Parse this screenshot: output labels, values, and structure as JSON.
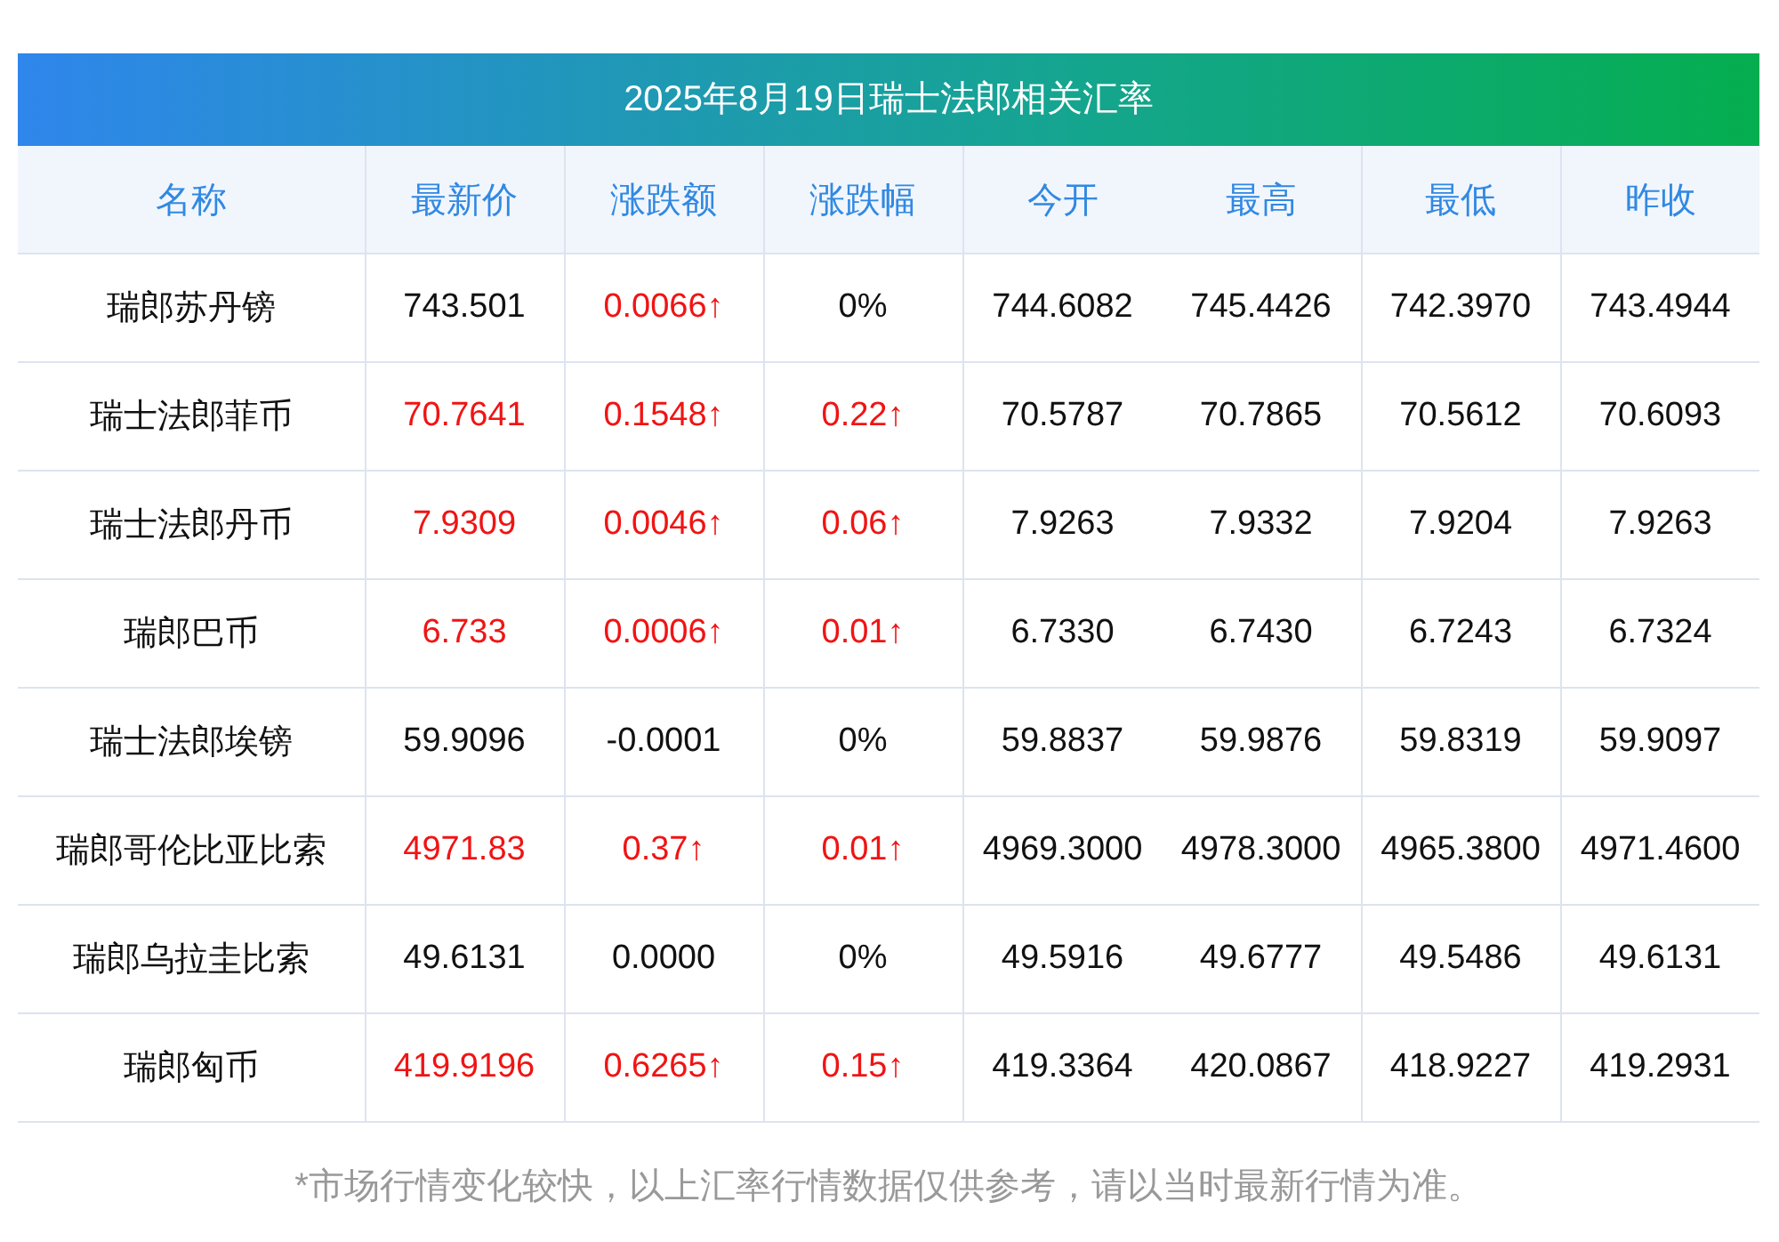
{
  "title": "2025年8月19日瑞士法郎相关汇率",
  "columns": [
    "名称",
    "最新价",
    "涨跌额",
    "涨跌幅",
    "今开",
    "最高",
    "最低",
    "昨收"
  ],
  "rows": [
    {
      "name": "瑞郎苏丹镑",
      "latest": {
        "text": "743.501",
        "up": false
      },
      "change": {
        "text": "0.0066↑",
        "up": true
      },
      "pct": {
        "text": "0%",
        "up": false
      },
      "open": "744.6082",
      "high": "745.4426",
      "low": "742.3970",
      "prev": "743.4944"
    },
    {
      "name": "瑞士法郎菲币",
      "latest": {
        "text": "70.7641",
        "up": true
      },
      "change": {
        "text": "0.1548↑",
        "up": true
      },
      "pct": {
        "text": "0.22↑",
        "up": true
      },
      "open": "70.5787",
      "high": "70.7865",
      "low": "70.5612",
      "prev": "70.6093"
    },
    {
      "name": "瑞士法郎丹币",
      "latest": {
        "text": "7.9309",
        "up": true
      },
      "change": {
        "text": "0.0046↑",
        "up": true
      },
      "pct": {
        "text": "0.06↑",
        "up": true
      },
      "open": "7.9263",
      "high": "7.9332",
      "low": "7.9204",
      "prev": "7.9263"
    },
    {
      "name": "瑞郎巴币",
      "latest": {
        "text": "6.733",
        "up": true
      },
      "change": {
        "text": "0.0006↑",
        "up": true
      },
      "pct": {
        "text": "0.01↑",
        "up": true
      },
      "open": "6.7330",
      "high": "6.7430",
      "low": "6.7243",
      "prev": "6.7324"
    },
    {
      "name": "瑞士法郎埃镑",
      "latest": {
        "text": "59.9096",
        "up": false
      },
      "change": {
        "text": "-0.0001",
        "up": false
      },
      "pct": {
        "text": "0%",
        "up": false
      },
      "open": "59.8837",
      "high": "59.9876",
      "low": "59.8319",
      "prev": "59.9097"
    },
    {
      "name": "瑞郎哥伦比亚比索",
      "latest": {
        "text": "4971.83",
        "up": true
      },
      "change": {
        "text": "0.37↑",
        "up": true
      },
      "pct": {
        "text": "0.01↑",
        "up": true
      },
      "open": "4969.3000",
      "high": "4978.3000",
      "low": "4965.3800",
      "prev": "4971.4600"
    },
    {
      "name": "瑞郎乌拉圭比索",
      "latest": {
        "text": "49.6131",
        "up": false
      },
      "change": {
        "text": "0.0000",
        "up": false
      },
      "pct": {
        "text": "0%",
        "up": false
      },
      "open": "49.5916",
      "high": "49.6777",
      "low": "49.5486",
      "prev": "49.6131"
    },
    {
      "name": "瑞郎匈币",
      "latest": {
        "text": "419.9196",
        "up": true
      },
      "change": {
        "text": "0.6265↑",
        "up": true
      },
      "pct": {
        "text": "0.15↑",
        "up": true
      },
      "open": "419.3364",
      "high": "420.0867",
      "low": "418.9227",
      "prev": "419.2931"
    }
  ],
  "footnote": "*市场行情变化较快，以上汇率行情数据仅供参考，请以当时最新行情为准。"
}
